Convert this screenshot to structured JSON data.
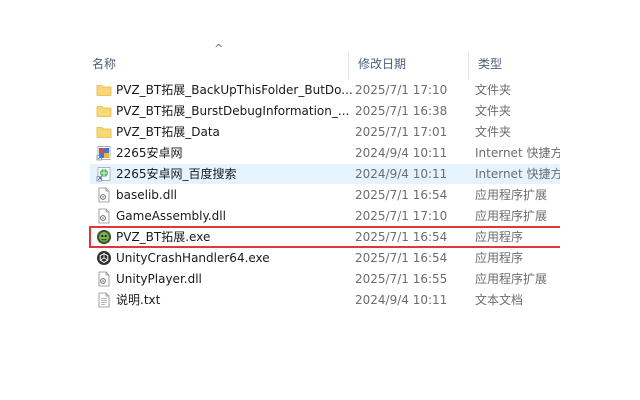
{
  "columns": {
    "name": "名称",
    "date": "修改日期",
    "type": "类型",
    "sort_indicator": "^"
  },
  "files": [
    {
      "name": "PVZ_BT拓展_BackUpThisFolder_ButDo...",
      "date": "2025/7/1 17:10",
      "type": "文件夹",
      "icon": "folder-icon"
    },
    {
      "name": "PVZ_BT拓展_BurstDebugInformation_...",
      "date": "2025/7/1 16:38",
      "type": "文件夹",
      "icon": "folder-icon"
    },
    {
      "name": "PVZ_BT拓展_Data",
      "date": "2025/7/1 17:01",
      "type": "文件夹",
      "icon": "folder-icon"
    },
    {
      "name": "2265安卓网",
      "date": "2024/9/4 10:11",
      "type": "Internet 快捷方",
      "icon": "internet-shortcut-icon"
    },
    {
      "name": "2265安卓网_百度搜索",
      "date": "2024/9/4 10:11",
      "type": "Internet 快捷方",
      "icon": "internet-shortcut-icon"
    },
    {
      "name": "baselib.dll",
      "date": "2025/7/1 16:54",
      "type": "应用程序扩展",
      "icon": "dll-file-icon"
    },
    {
      "name": "GameAssembly.dll",
      "date": "2025/7/1 17:10",
      "type": "应用程序扩展",
      "icon": "dll-file-icon"
    },
    {
      "name": "PVZ_BT拓展.exe",
      "date": "2025/7/1 16:54",
      "type": "应用程序",
      "icon": "game-exe-icon"
    },
    {
      "name": "UnityCrashHandler64.exe",
      "date": "2025/7/1 16:54",
      "type": "应用程序",
      "icon": "unity-exe-icon"
    },
    {
      "name": "UnityPlayer.dll",
      "date": "2025/7/1 16:55",
      "type": "应用程序扩展",
      "icon": "dll-file-icon"
    },
    {
      "name": "说明.txt",
      "date": "2024/9/4 10:11",
      "type": "文本文档",
      "icon": "text-file-icon"
    }
  ],
  "colors": {
    "header_text": "#4c607a",
    "hover_row": "#e5f3ff",
    "selection_box": "#e0383a",
    "folder": "#f8d775",
    "secondary_text": "#6d6d6d"
  }
}
